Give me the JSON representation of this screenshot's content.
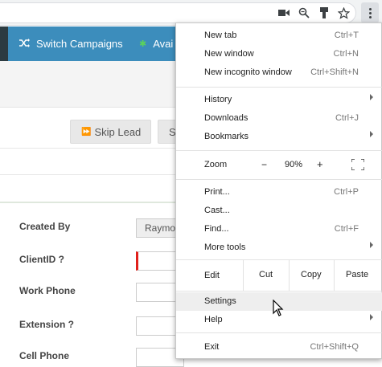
{
  "browser": {
    "icons": [
      "camera-icon",
      "zoom-icon",
      "extension-icon",
      "star-icon",
      "menu-dots-icon"
    ]
  },
  "app_nav": {
    "switch_campaigns_label": "Switch Campaigns",
    "available_label": "Avai"
  },
  "toolbar_buttons": {
    "skip_lead_label": "Skip Lead",
    "second_label": "S"
  },
  "form": {
    "created_by_label": "Created By",
    "created_by_value": "Raymo",
    "clientid_label": "ClientID ?",
    "work_phone_label": "Work Phone",
    "extension_label": "Extension ?",
    "cell_phone_label": "Cell Phone"
  },
  "menu": {
    "new_tab": {
      "label": "New tab",
      "shortcut": "Ctrl+T"
    },
    "new_window": {
      "label": "New window",
      "shortcut": "Ctrl+N"
    },
    "new_incognito": {
      "label": "New incognito window",
      "shortcut": "Ctrl+Shift+N"
    },
    "history": {
      "label": "History"
    },
    "downloads": {
      "label": "Downloads",
      "shortcut": "Ctrl+J"
    },
    "bookmarks": {
      "label": "Bookmarks"
    },
    "zoom": {
      "label": "Zoom",
      "minus": "−",
      "value": "90%",
      "plus": "+"
    },
    "print": {
      "label": "Print...",
      "shortcut": "Ctrl+P"
    },
    "cast": {
      "label": "Cast..."
    },
    "find": {
      "label": "Find...",
      "shortcut": "Ctrl+F"
    },
    "more_tools": {
      "label": "More tools"
    },
    "edit": {
      "label": "Edit",
      "cut": "Cut",
      "copy": "Copy",
      "paste": "Paste"
    },
    "settings": {
      "label": "Settings"
    },
    "help": {
      "label": "Help"
    },
    "exit": {
      "label": "Exit",
      "shortcut": "Ctrl+Shift+Q"
    }
  }
}
